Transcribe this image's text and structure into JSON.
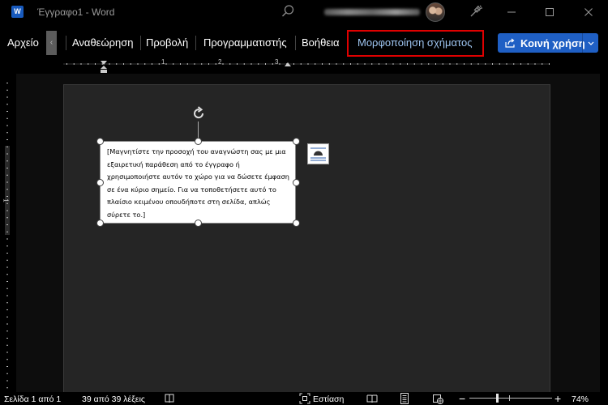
{
  "window": {
    "app_badge": "W",
    "title": "Έγγραφο1  -  Word"
  },
  "ribbon": {
    "tabs": [
      {
        "label": "Αρχείο"
      },
      {
        "label": "Αναθεώρηση"
      },
      {
        "label": "Προβολή"
      },
      {
        "label": "Προγραμματιστής"
      },
      {
        "label": "Βοήθεια"
      },
      {
        "label": "Μορφοποίηση σχήματος"
      }
    ],
    "scroll_glyph": "‹",
    "share_label": "Κοινή χρήση",
    "accent_color": "#1f5fc4",
    "active_tab_color": "#9fc6f2",
    "highlight_color": "#e00000"
  },
  "ruler": {
    "numbers": [
      "1",
      "2",
      "3"
    ],
    "vertical_number": "1"
  },
  "textbox": {
    "text": "[Μαγνητίστε την προσοχή του αναγνώστη σας με μια εξαιρετική παράθεση από το έγγραφο ή χρησιμοποιήστε αυτόν το χώρο για να δώσετε έμφαση σε ένα κύριο σημείο. Για να τοποθετήσετε αυτό το πλαίσιο κειμένου οπουδήποτε στη σελίδα, απλώς σύρετε το.]"
  },
  "statusbar": {
    "page_info": "Σελίδα 1 από 1",
    "word_count": "39 από 39 λέξεις",
    "focus_label": "Εστίαση",
    "zoom_minus": "−",
    "zoom_plus": "+",
    "zoom_level": "74%",
    "zoom_fraction": 0.74
  },
  "icons": [
    "word-logo-icon",
    "search-icon",
    "avatar",
    "designer-icon",
    "minimize-icon",
    "maximize-icon",
    "close-icon",
    "share-icon",
    "chevron-down-icon",
    "rotate-icon",
    "layout-options-icon",
    "proofing-book-icon",
    "focus-icon",
    "read-mode-icon",
    "print-layout-icon",
    "web-layout-icon"
  ]
}
